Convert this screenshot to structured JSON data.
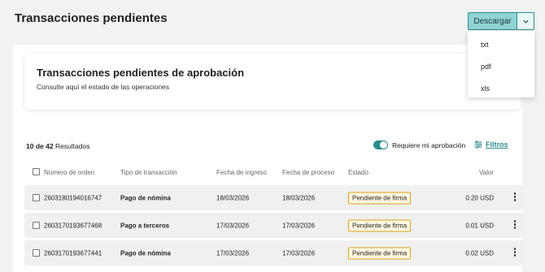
{
  "page": {
    "title": "Transacciones pendientes"
  },
  "download": {
    "label": "Descargar",
    "options": [
      "txt",
      "pdf",
      "xls"
    ]
  },
  "approval_card": {
    "title": "Transacciones pendientes de aprobación",
    "subtitle": "Consulte aquí el estado de las operaciones"
  },
  "results": {
    "shown": "10 de 42",
    "label": "Resultados"
  },
  "approval_toggle": {
    "label": "Requiere mi aprobación",
    "on": true
  },
  "filters": {
    "label": "Filtros"
  },
  "table": {
    "headers": {
      "order": "Número de orden",
      "type": "Tipo de transacción",
      "entry_date": "Fecha de ingreso",
      "process_date": "Fecha de proceso",
      "status": "Estado",
      "value": "Valor"
    },
    "rows": [
      {
        "order": "2603180194016747",
        "type": "Pago de nómina",
        "entry_date": "18/03/2026",
        "process_date": "18/03/2026",
        "status": "Pendiente de firma",
        "value": "0.20 USD"
      },
      {
        "order": "2603170193677468",
        "type": "Pago a terceros",
        "entry_date": "17/03/2026",
        "process_date": "17/03/2026",
        "status": "Pendiente de firma",
        "value": "0.01 USD"
      },
      {
        "order": "2603170193677441",
        "type": "Pago de nómina",
        "entry_date": "17/03/2026",
        "process_date": "17/03/2026",
        "status": "Pendiente de firma",
        "value": "0.02 USD"
      }
    ]
  },
  "colors": {
    "accent": "#2d8b8f",
    "download_button": "#8fd3d6",
    "status_border": "#d9a21b",
    "row_background": "#f0f0f0",
    "page_background": "#f2f2f2"
  },
  "icons": {
    "download_toggle": "chevron-down-icon",
    "filters": "sliders-icon",
    "row_actions": "kebab-menu-icon"
  }
}
